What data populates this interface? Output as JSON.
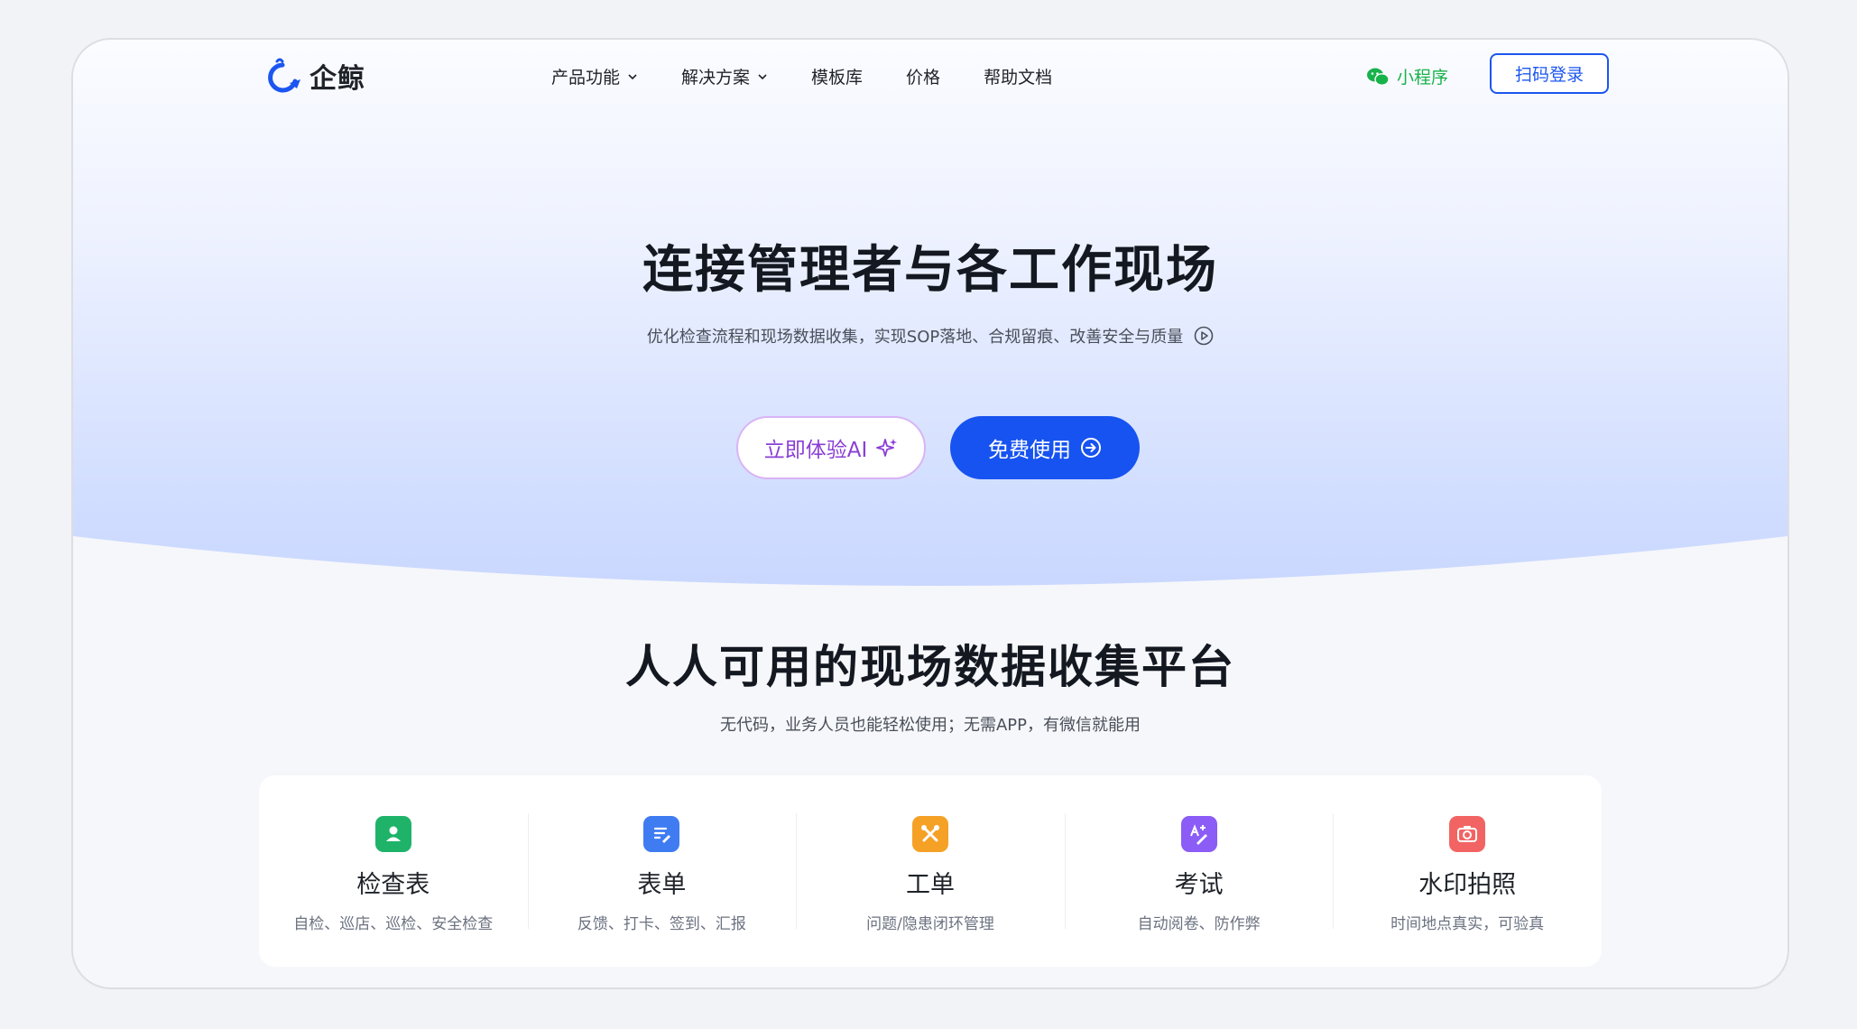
{
  "brand": {
    "name": "企鲸",
    "logo_icon": "whale-logo-icon",
    "accent": "#1b56f0"
  },
  "nav": {
    "items": [
      {
        "label": "产品功能",
        "has_dropdown": true
      },
      {
        "label": "解决方案",
        "has_dropdown": true
      },
      {
        "label": "模板库",
        "has_dropdown": false
      },
      {
        "label": "价格",
        "has_dropdown": false
      },
      {
        "label": "帮助文档",
        "has_dropdown": false
      }
    ],
    "mini_program": {
      "label": "小程序",
      "icon": "wechat-icon",
      "color": "#18b24a"
    },
    "login_label": "扫码登录"
  },
  "hero": {
    "title": "连接管理者与各工作现场",
    "subtitle": "优化检查流程和现场数据收集，实现SOP落地、合规留痕、改善安全与质量",
    "subtitle_icon": "play-circle-icon",
    "btn_ai": {
      "label": "立即体验AI",
      "icon": "sparkle-icon",
      "color": "#8a3fd6"
    },
    "btn_free": {
      "label": "免费使用",
      "icon": "arrow-circle-right-icon",
      "color": "#1753f0"
    }
  },
  "section": {
    "title": "人人可用的现场数据收集平台",
    "subtitle": "无代码，业务人员也能轻松使用；无需APP，有微信就能用"
  },
  "features": [
    {
      "name": "检查表",
      "desc": "自检、巡店、巡检、安全检查",
      "icon": "checklist-user-icon",
      "color": "#1fb36a"
    },
    {
      "name": "表单",
      "desc": "反馈、打卡、签到、汇报",
      "icon": "form-edit-icon",
      "color": "#3f7cf2"
    },
    {
      "name": "工单",
      "desc": "问题/隐患闭环管理",
      "icon": "tools-icon",
      "color": "#f5a126"
    },
    {
      "name": "考试",
      "desc": "自动阅卷、防作弊",
      "icon": "exam-pen-icon",
      "color": "#8b5cf6"
    },
    {
      "name": "水印拍照",
      "desc": "时间地点真实，可验真",
      "icon": "camera-icon",
      "color": "#f26464"
    }
  ]
}
